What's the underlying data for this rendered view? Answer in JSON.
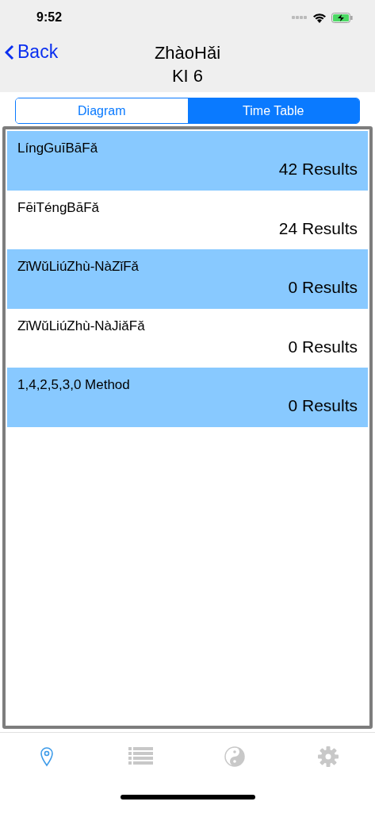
{
  "status_bar": {
    "time": "9:52"
  },
  "nav": {
    "back": "Back",
    "title": "ZhàoHǎi",
    "subtitle": "KI 6"
  },
  "segments": [
    {
      "label": "Diagram",
      "selected": false
    },
    {
      "label": "Time Table",
      "selected": true
    }
  ],
  "rows": [
    {
      "name": "LíngGuīBāFǎ",
      "results": "42 Results",
      "highlighted": true
    },
    {
      "name": "FēiTéngBāFǎ",
      "results": "24 Results",
      "highlighted": false
    },
    {
      "name": "ZǐWǔLiúZhù-NàZǐFǎ",
      "results": "0 Results",
      "highlighted": true
    },
    {
      "name": "ZǐWǔLiúZhù-NàJiǎFǎ",
      "results": "0 Results",
      "highlighted": false
    },
    {
      "name": "1,4,2,5,3,0 Method",
      "results": "0 Results",
      "highlighted": true
    }
  ],
  "tab_bar": [
    {
      "kind": "pin",
      "selected": true
    },
    {
      "kind": "list",
      "selected": false
    },
    {
      "kind": "yinyang",
      "selected": false
    },
    {
      "kind": "gear",
      "selected": false
    }
  ]
}
